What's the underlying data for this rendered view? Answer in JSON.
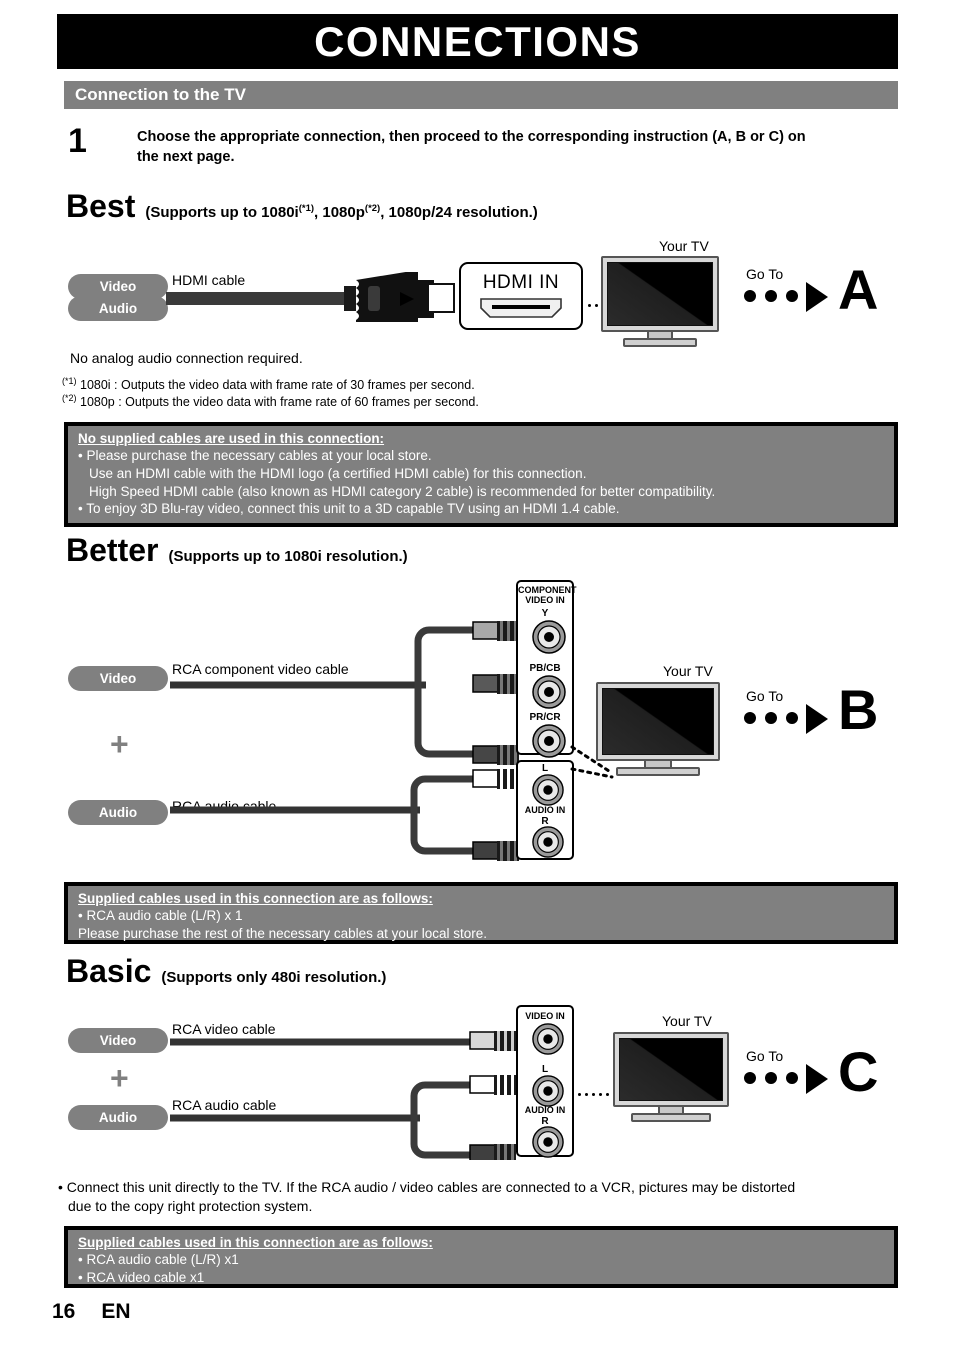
{
  "header": {
    "title": "CONNECTIONS",
    "section_bar": "Connection to the TV"
  },
  "step": {
    "number": "1",
    "text": "Choose the appropriate connection, then proceed to the corresponding instruction (A, B or C) on the next page."
  },
  "tiers": {
    "best": {
      "word": "Best",
      "sub_pre": "(Supports up to 1080i",
      "sup1": "(*1)",
      "sub_mid": ", 1080p",
      "sup2": "(*2)",
      "sub_post": ", 1080p/24 resolution.)"
    },
    "better": {
      "word": "Better",
      "sub": "(Supports up to 1080i resolution.)"
    },
    "basic": {
      "word": "Basic",
      "sub": "(Supports only 480i resolution.)"
    }
  },
  "best_diagram": {
    "pill_video": "Video",
    "pill_audio": "Audio",
    "cable_label": "HDMI cable",
    "hdmi_in": "HDMI IN",
    "your_tv": "Your TV",
    "go_to": "Go To",
    "letter": "A",
    "no_analog": "No analog audio connection required.",
    "footnote1_sup": "(*1)",
    "footnote1": "1080i  : Outputs the video data with frame rate of 30 frames per second.",
    "footnote2_sup": "(*2)",
    "footnote2": "1080p : Outputs the video data with frame rate of 60 frames per second."
  },
  "note_best": {
    "header": "No supplied cables are used in this connection:",
    "line1": "• Please purchase the necessary cables at your local store.",
    "line2": "Use an HDMI cable with the HDMI logo (a certified HDMI cable) for this connection.",
    "line3": "High Speed HDMI cable (also known as HDMI category 2 cable) is recommended for better compatibility.",
    "line4": "• To enjoy 3D Blu-ray video, connect this unit to a 3D capable TV using an HDMI 1.4 cable."
  },
  "better_diagram": {
    "pill_video": "Video",
    "pill_audio": "Audio",
    "plus": "+",
    "video_cable_label": "RCA component video cable",
    "audio_cable_label": "RCA audio cable",
    "panel_component_title_l1": "COMPONENT",
    "panel_component_title_l2": "VIDEO IN",
    "jack_y": "Y",
    "jack_pb": "PB/CB",
    "jack_pr": "PR/CR",
    "panel_audio_l": "L",
    "panel_audio_title": "AUDIO IN",
    "panel_audio_r": "R",
    "your_tv": "Your TV",
    "go_to": "Go To",
    "letter": "B"
  },
  "note_better": {
    "header": "Supplied cables used in this connection are as follows:",
    "line1": "• RCA audio cable (L/R) x 1",
    "line2": "Please purchase the rest of the necessary cables at your local store."
  },
  "basic_diagram": {
    "pill_video": "Video",
    "pill_audio": "Audio",
    "plus": "+",
    "video_cable_label": "RCA video cable",
    "audio_cable_label": "RCA audio cable",
    "panel_video_in": "VIDEO IN",
    "panel_audio_l": "L",
    "panel_audio_title": "AUDIO IN",
    "panel_audio_r": "R",
    "your_tv": "Your TV",
    "go_to": "Go To",
    "letter": "C"
  },
  "basic_caution": {
    "line1": "• Connect this unit directly to the TV. If the RCA audio / video cables are connected to a VCR, pictures may be distorted",
    "line2": "due to the copy right protection system."
  },
  "note_basic": {
    "header": "Supplied cables used in this connection are as follows:",
    "line1": "• RCA audio cable (L/R) x1",
    "line2": "• RCA video cable x1"
  },
  "footer": {
    "page": "16",
    "lang": "EN"
  }
}
